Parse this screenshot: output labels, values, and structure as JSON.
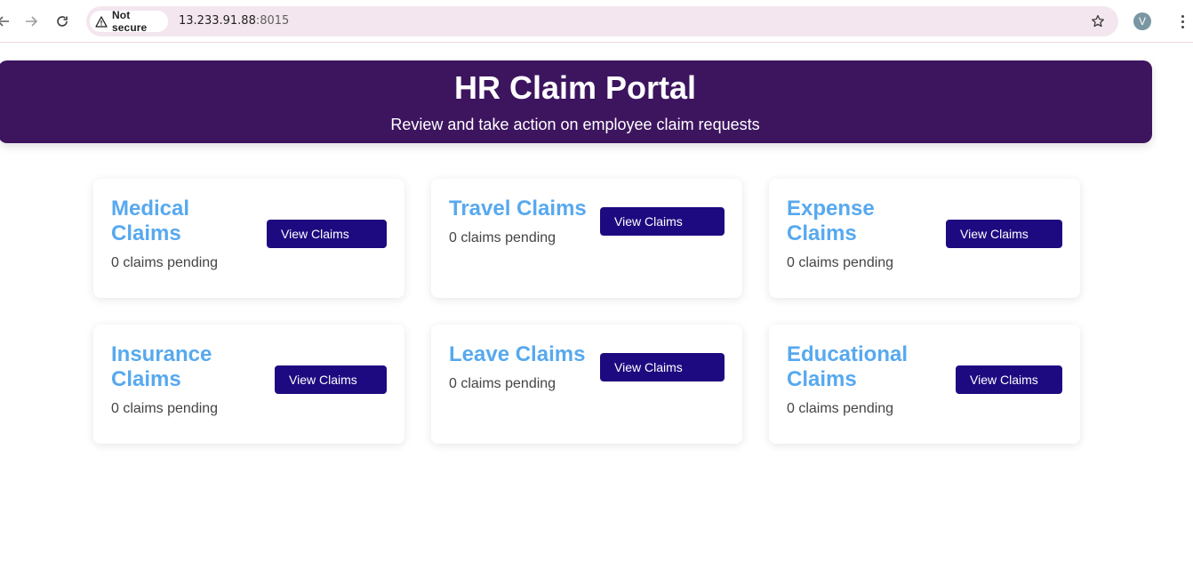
{
  "browser": {
    "security_label": "Not secure",
    "url_host": "13.233.91.88",
    "url_port": ":8015",
    "profile_initial": "V"
  },
  "header": {
    "title": "HR Claim Portal",
    "subtitle": "Review and take action on employee claim requests",
    "background_color": "#3d155f"
  },
  "colors": {
    "card_title": "#57a9ef",
    "button_bg": "#1e0a80"
  },
  "cards": [
    {
      "title_line1": "Medical",
      "title_line2": "Claims",
      "status": "0 claims pending",
      "button_label": "View Claims"
    },
    {
      "title_line1": "Travel Claims",
      "title_line2": "",
      "status": "0 claims pending",
      "button_label": "View Claims"
    },
    {
      "title_line1": "Expense",
      "title_line2": "Claims",
      "status": "0 claims pending",
      "button_label": "View Claims"
    },
    {
      "title_line1": "Insurance",
      "title_line2": "Claims",
      "status": "0 claims pending",
      "button_label": "View Claims"
    },
    {
      "title_line1": "Leave Claims",
      "title_line2": "",
      "status": "0 claims pending",
      "button_label": "View Claims"
    },
    {
      "title_line1": "Educational",
      "title_line2": "Claims",
      "status": "0 claims pending",
      "button_label": "View Claims"
    }
  ]
}
